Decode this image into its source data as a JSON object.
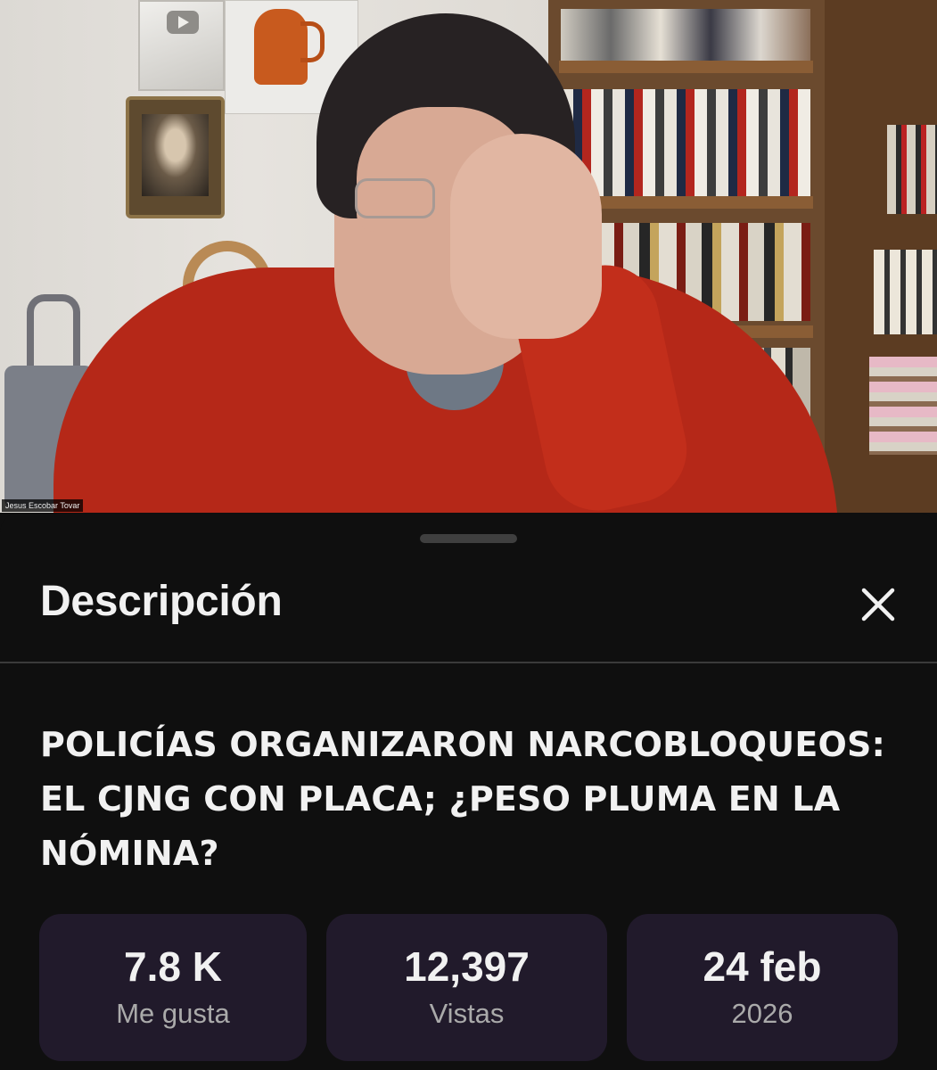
{
  "video": {
    "participant_name": "Jesus Escobar Tovar"
  },
  "sheet": {
    "title": "Descripción",
    "close_icon": "close-icon"
  },
  "description": {
    "video_title": "POLICÍAS ORGANIZARON NARCOBLOQUEOS: EL CJNG CON PLACA; ¿PESO PLUMA EN LA NÓMINA?"
  },
  "stats": {
    "likes": {
      "value": "7.8 K",
      "label": "Me gusta"
    },
    "views": {
      "value": "12,397",
      "label": "Vistas"
    },
    "date": {
      "value": "24 feb",
      "label": "2026"
    }
  },
  "colors": {
    "background": "#0f0f0f",
    "stat_card": "#211a2b",
    "text_primary": "#f1f1f1",
    "text_secondary": "#aaaaaa"
  }
}
